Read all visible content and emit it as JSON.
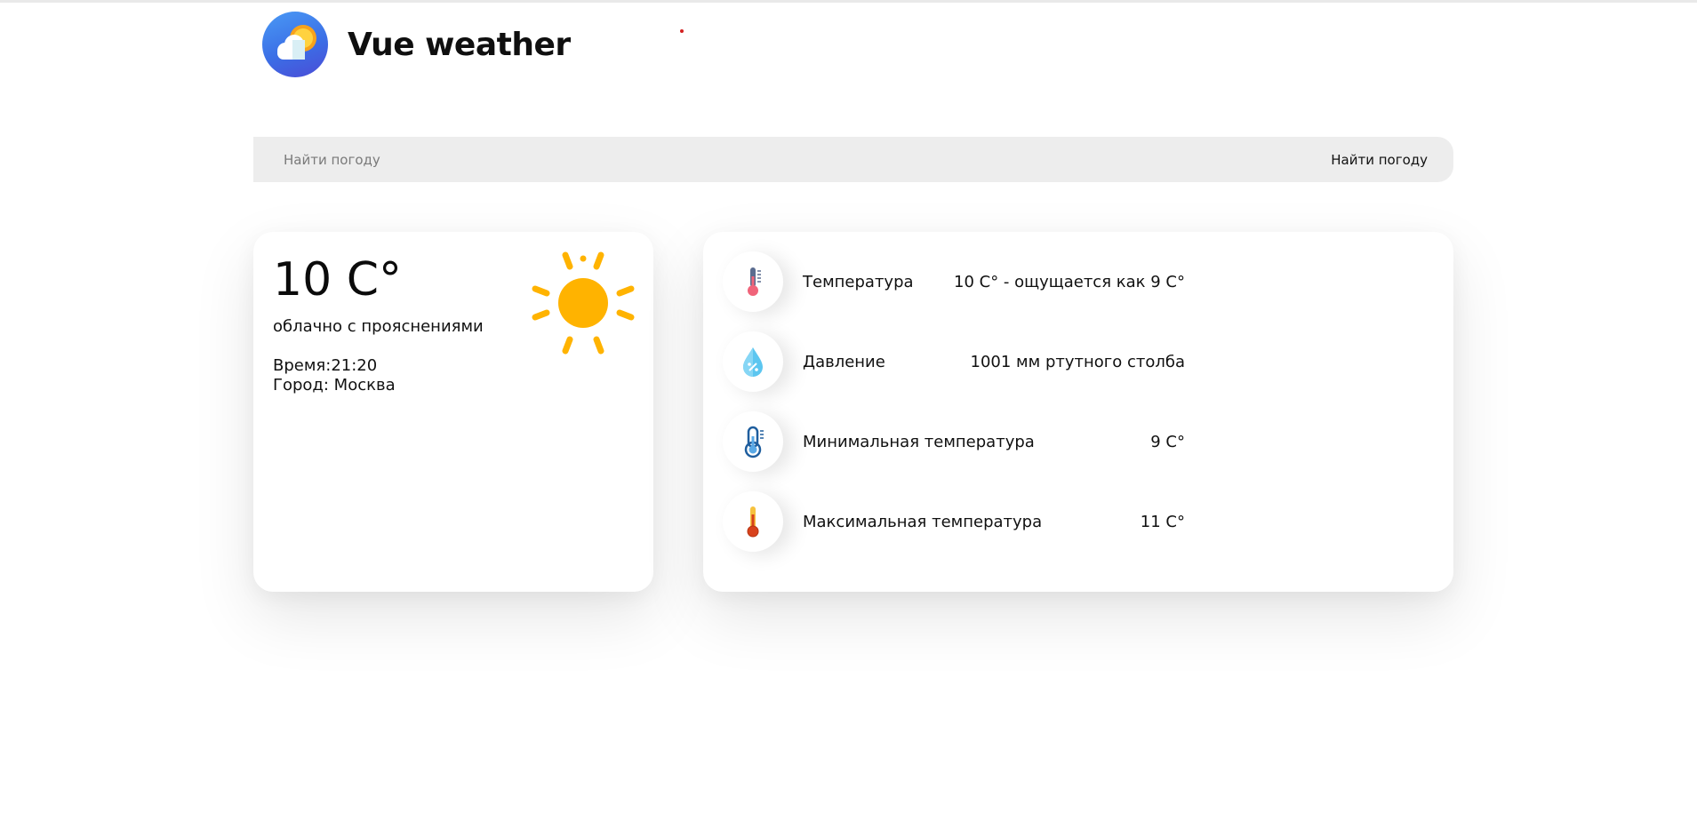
{
  "app": {
    "title": "Vue weather",
    "logo_icon": "weather-logo-icon"
  },
  "search": {
    "placeholder": "Найти погоду",
    "value": "",
    "button_label": "Найти погоду"
  },
  "current": {
    "temperature": "10 C°",
    "description": "облачно с прояснениями",
    "time": "Время:21:20",
    "city": "Город: Москва",
    "icon": "sun-icon"
  },
  "details": [
    {
      "icon": "thermometer-icon",
      "label": "Температура",
      "value": "10 C° - ощущается как 9 C°"
    },
    {
      "icon": "pressure-drop-icon",
      "label": "Давление",
      "value": "1001 мм ртутного столба"
    },
    {
      "icon": "min-temperature-icon",
      "label": "Минимальная температура",
      "value": "9 C°"
    },
    {
      "icon": "max-temperature-icon",
      "label": "Максимальная температура",
      "value": "11 C°"
    }
  ],
  "colors": {
    "accent_sun": "#ffb300",
    "search_background": "#ededed",
    "logo_blue": "#3b6fe6"
  }
}
